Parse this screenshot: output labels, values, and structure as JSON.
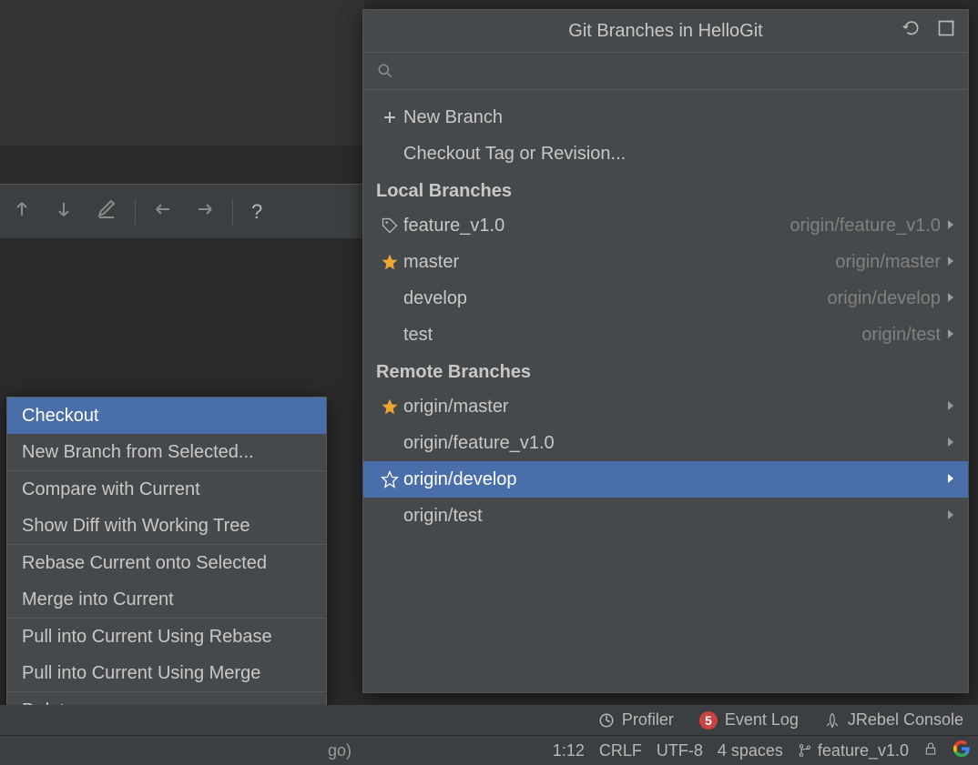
{
  "popup": {
    "title": "Git Branches in HelloGit",
    "top_items": [
      {
        "label": "New Branch",
        "has_plus": true
      },
      {
        "label": "Checkout Tag or Revision...",
        "has_plus": false
      }
    ],
    "local_header": "Local Branches",
    "local_branches": [
      {
        "label": "feature_v1.0",
        "icon": "tag",
        "tracking": "origin/feature_v1.0"
      },
      {
        "label": "master",
        "icon": "star-filled",
        "tracking": "origin/master"
      },
      {
        "label": "develop",
        "icon": "",
        "tracking": "origin/develop"
      },
      {
        "label": "test",
        "icon": "",
        "tracking": "origin/test"
      }
    ],
    "remote_header": "Remote Branches",
    "remote_branches": [
      {
        "label": "origin/master",
        "icon": "star-filled",
        "selected": false
      },
      {
        "label": "origin/feature_v1.0",
        "icon": "",
        "selected": false
      },
      {
        "label": "origin/develop",
        "icon": "star-outline",
        "selected": true
      },
      {
        "label": "origin/test",
        "icon": "",
        "selected": false
      }
    ]
  },
  "context_menu": {
    "groups": [
      [
        "Checkout",
        "New Branch from Selected..."
      ],
      [
        "Compare with Current",
        "Show Diff with Working Tree"
      ],
      [
        "Rebase Current onto Selected",
        "Merge into Current"
      ],
      [
        "Pull into Current Using Rebase",
        "Pull into Current Using Merge"
      ],
      [
        "Delete"
      ]
    ],
    "selected": "Checkout"
  },
  "statusbar": {
    "profiler": "Profiler",
    "event_log_count": "5",
    "event_log": "Event Log",
    "jrebel": "JRebel Console",
    "left_text": "go)",
    "cursor": "1:12",
    "line_sep": "CRLF",
    "encoding": "UTF-8",
    "indent": "4 spaces",
    "branch": "feature_v1.0"
  },
  "toolbar_help": "?"
}
